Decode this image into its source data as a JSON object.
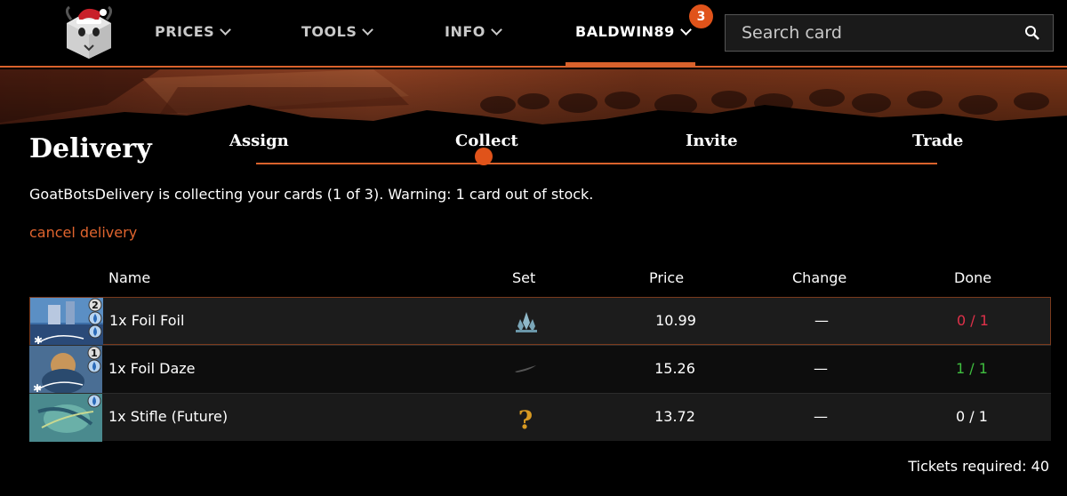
{
  "nav": {
    "items": [
      {
        "label": "PRICES"
      },
      {
        "label": "TOOLS"
      },
      {
        "label": "INFO"
      }
    ],
    "user": {
      "label": "BALDWIN89",
      "badge": "3"
    },
    "search": {
      "placeholder": "Search card"
    },
    "icons": {
      "logo": "goat-santa-logo",
      "search": "search-icon",
      "dropdown": "chevron-down-icon"
    },
    "accent_color": "#d9622c"
  },
  "page": {
    "title": "Delivery",
    "steps": [
      {
        "label": "Assign"
      },
      {
        "label": "Collect"
      },
      {
        "label": "Invite"
      },
      {
        "label": "Trade"
      }
    ],
    "current_step": "Collect",
    "status_text": "GoatBotsDelivery is collecting your cards (1 of 3). Warning: 1 card out of stock.",
    "cancel_label": "cancel delivery"
  },
  "table": {
    "headers": {
      "name": "Name",
      "set": "Set",
      "price": "Price",
      "change": "Change",
      "done": "Done"
    },
    "rows": [
      {
        "name": "1x Foil Foil",
        "mana_cost": "2 blue blue",
        "set_icon": "crystal-set-icon",
        "price": "10.99",
        "change": "—",
        "done": "0 / 1",
        "done_color": "#e0314a"
      },
      {
        "name": "1x Foil Daze",
        "mana_cost": "1 blue",
        "set_icon": "feather-set-icon",
        "price": "15.26",
        "change": "—",
        "done": "1 / 1",
        "done_color": "#3fbf3f"
      },
      {
        "name": "1x Stifle (Future)",
        "mana_cost": "blue",
        "set_icon": "unknown-set-icon",
        "price": "13.72",
        "change": "—",
        "done": "0 / 1",
        "done_color": "#ffffff"
      }
    ]
  },
  "footer": {
    "tickets_label": "Tickets required: 40"
  }
}
